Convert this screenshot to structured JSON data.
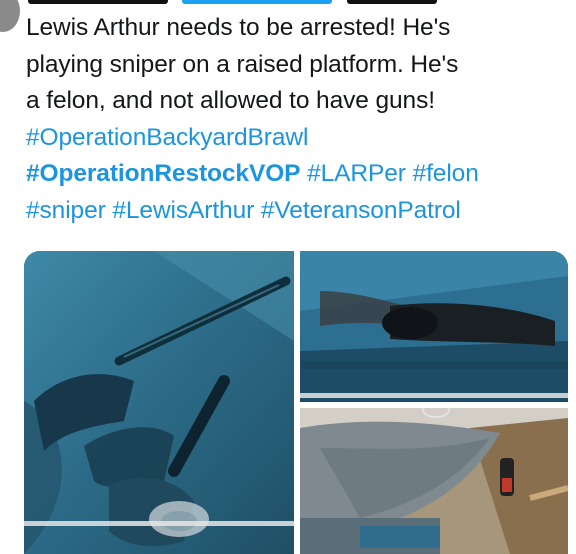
{
  "tweet": {
    "lines": [
      "Lewis Arthur needs to be arrested!  He's",
      "playing sniper on a raised platform. He's",
      "a felon, and not allowed to have guns!"
    ],
    "hashtags": {
      "backyard_brawl": "#OperationBackyardBrawl",
      "restock_vop": "#OperationRestockVOP",
      "larper": "#LARPer",
      "felon": "#felon",
      "sniper": "#sniper",
      "lewis_arthur": "#LewisArthur",
      "veterans_on_patrol": "#VeteransonPatrol"
    }
  },
  "media": {
    "photos": [
      {
        "name": "rifle-photo",
        "subject": "rifle"
      },
      {
        "name": "scope-photo",
        "subject": "scope"
      },
      {
        "name": "platform-photo",
        "subject": "tarp-platform"
      }
    ]
  },
  "colors": {
    "hashtag": "#1b95e0",
    "text": "#14171a"
  }
}
